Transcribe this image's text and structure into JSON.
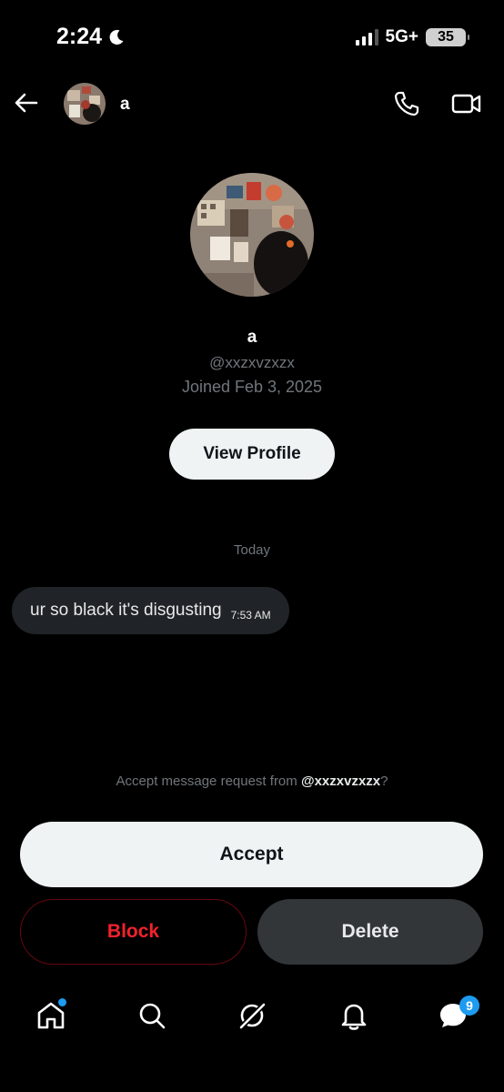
{
  "status_bar": {
    "time": "2:24",
    "network": "5G+",
    "battery": "35",
    "signal_bars_active": 3,
    "signal_bars_total": 4
  },
  "header": {
    "name": "a"
  },
  "profile": {
    "name": "a",
    "handle": "@xxzxvzxzx",
    "joined": "Joined Feb 3, 2025",
    "view_profile_label": "View Profile"
  },
  "conversation": {
    "day_label": "Today",
    "messages": [
      {
        "text": "ur so black it's disgusting",
        "time": "7:53 AM"
      }
    ]
  },
  "request": {
    "prompt_prefix": "Accept message request from ",
    "prompt_handle": "@xxzxvzxzx",
    "prompt_suffix": "?",
    "accept_label": "Accept",
    "block_label": "Block",
    "delete_label": "Delete"
  },
  "bottom_nav": {
    "items": [
      {
        "icon": "home-icon",
        "has_dot": true
      },
      {
        "icon": "search-icon"
      },
      {
        "icon": "grok-icon"
      },
      {
        "icon": "bell-icon"
      },
      {
        "icon": "messages-icon",
        "badge": "9"
      }
    ]
  },
  "colors": {
    "background": "#000000",
    "accent": "#1d9bf0",
    "danger": "#f4212e",
    "bubble": "#202327",
    "muted": "#71767b"
  }
}
